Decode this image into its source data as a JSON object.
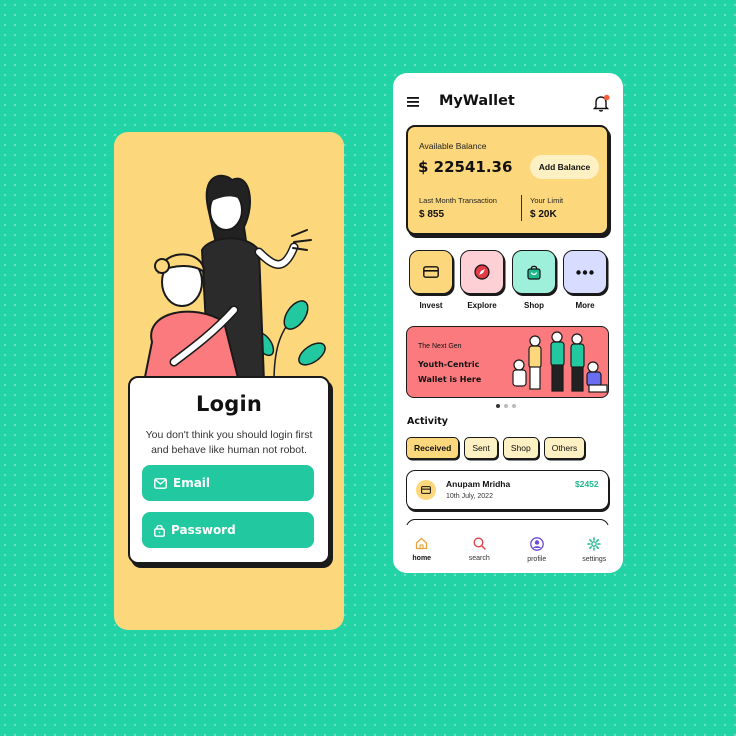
{
  "login": {
    "title": "Login",
    "subtitle": "You don't think you should login first and behave like human not robot.",
    "email_label": "Email",
    "password_label": "Password"
  },
  "wallet": {
    "app_title": "MyWallet",
    "balance": {
      "label": "Available Balance",
      "value": "$ 22541.36",
      "add_button": "Add Balance",
      "last_label": "Last Month Transaction",
      "last_value": "$ 855",
      "limit_label": "Your Limit",
      "limit_value": "$ 20K"
    },
    "quick_actions": [
      {
        "label": "Invest",
        "icon": "card-icon",
        "color": "#fcd77c"
      },
      {
        "label": "Explore",
        "icon": "compass-icon",
        "color": "#fdd0d6"
      },
      {
        "label": "Shop",
        "icon": "bag-icon",
        "color": "#9ff0da"
      },
      {
        "label": "More",
        "icon": "more-icon",
        "color": "#d8dcff"
      }
    ],
    "banner": {
      "small": "The Next Gen",
      "big": "Youth-Centric Wallet is Here"
    },
    "activity_title": "Activity",
    "filters": [
      "Received",
      "Sent",
      "Shop",
      "Others"
    ],
    "transactions": [
      {
        "name": "Anupam Mridha",
        "date": "10th July, 2022",
        "amount": "$2452"
      }
    ],
    "nav": [
      {
        "label": "home",
        "icon": "home-icon"
      },
      {
        "label": "search",
        "icon": "search-icon"
      },
      {
        "label": "profile",
        "icon": "profile-icon"
      },
      {
        "label": "settings",
        "icon": "gear-icon"
      }
    ],
    "colors": {
      "accent": "#22c9a0",
      "yellow": "#fcd77c",
      "coral": "#fb7a7e",
      "background": "#22d3a6"
    }
  }
}
